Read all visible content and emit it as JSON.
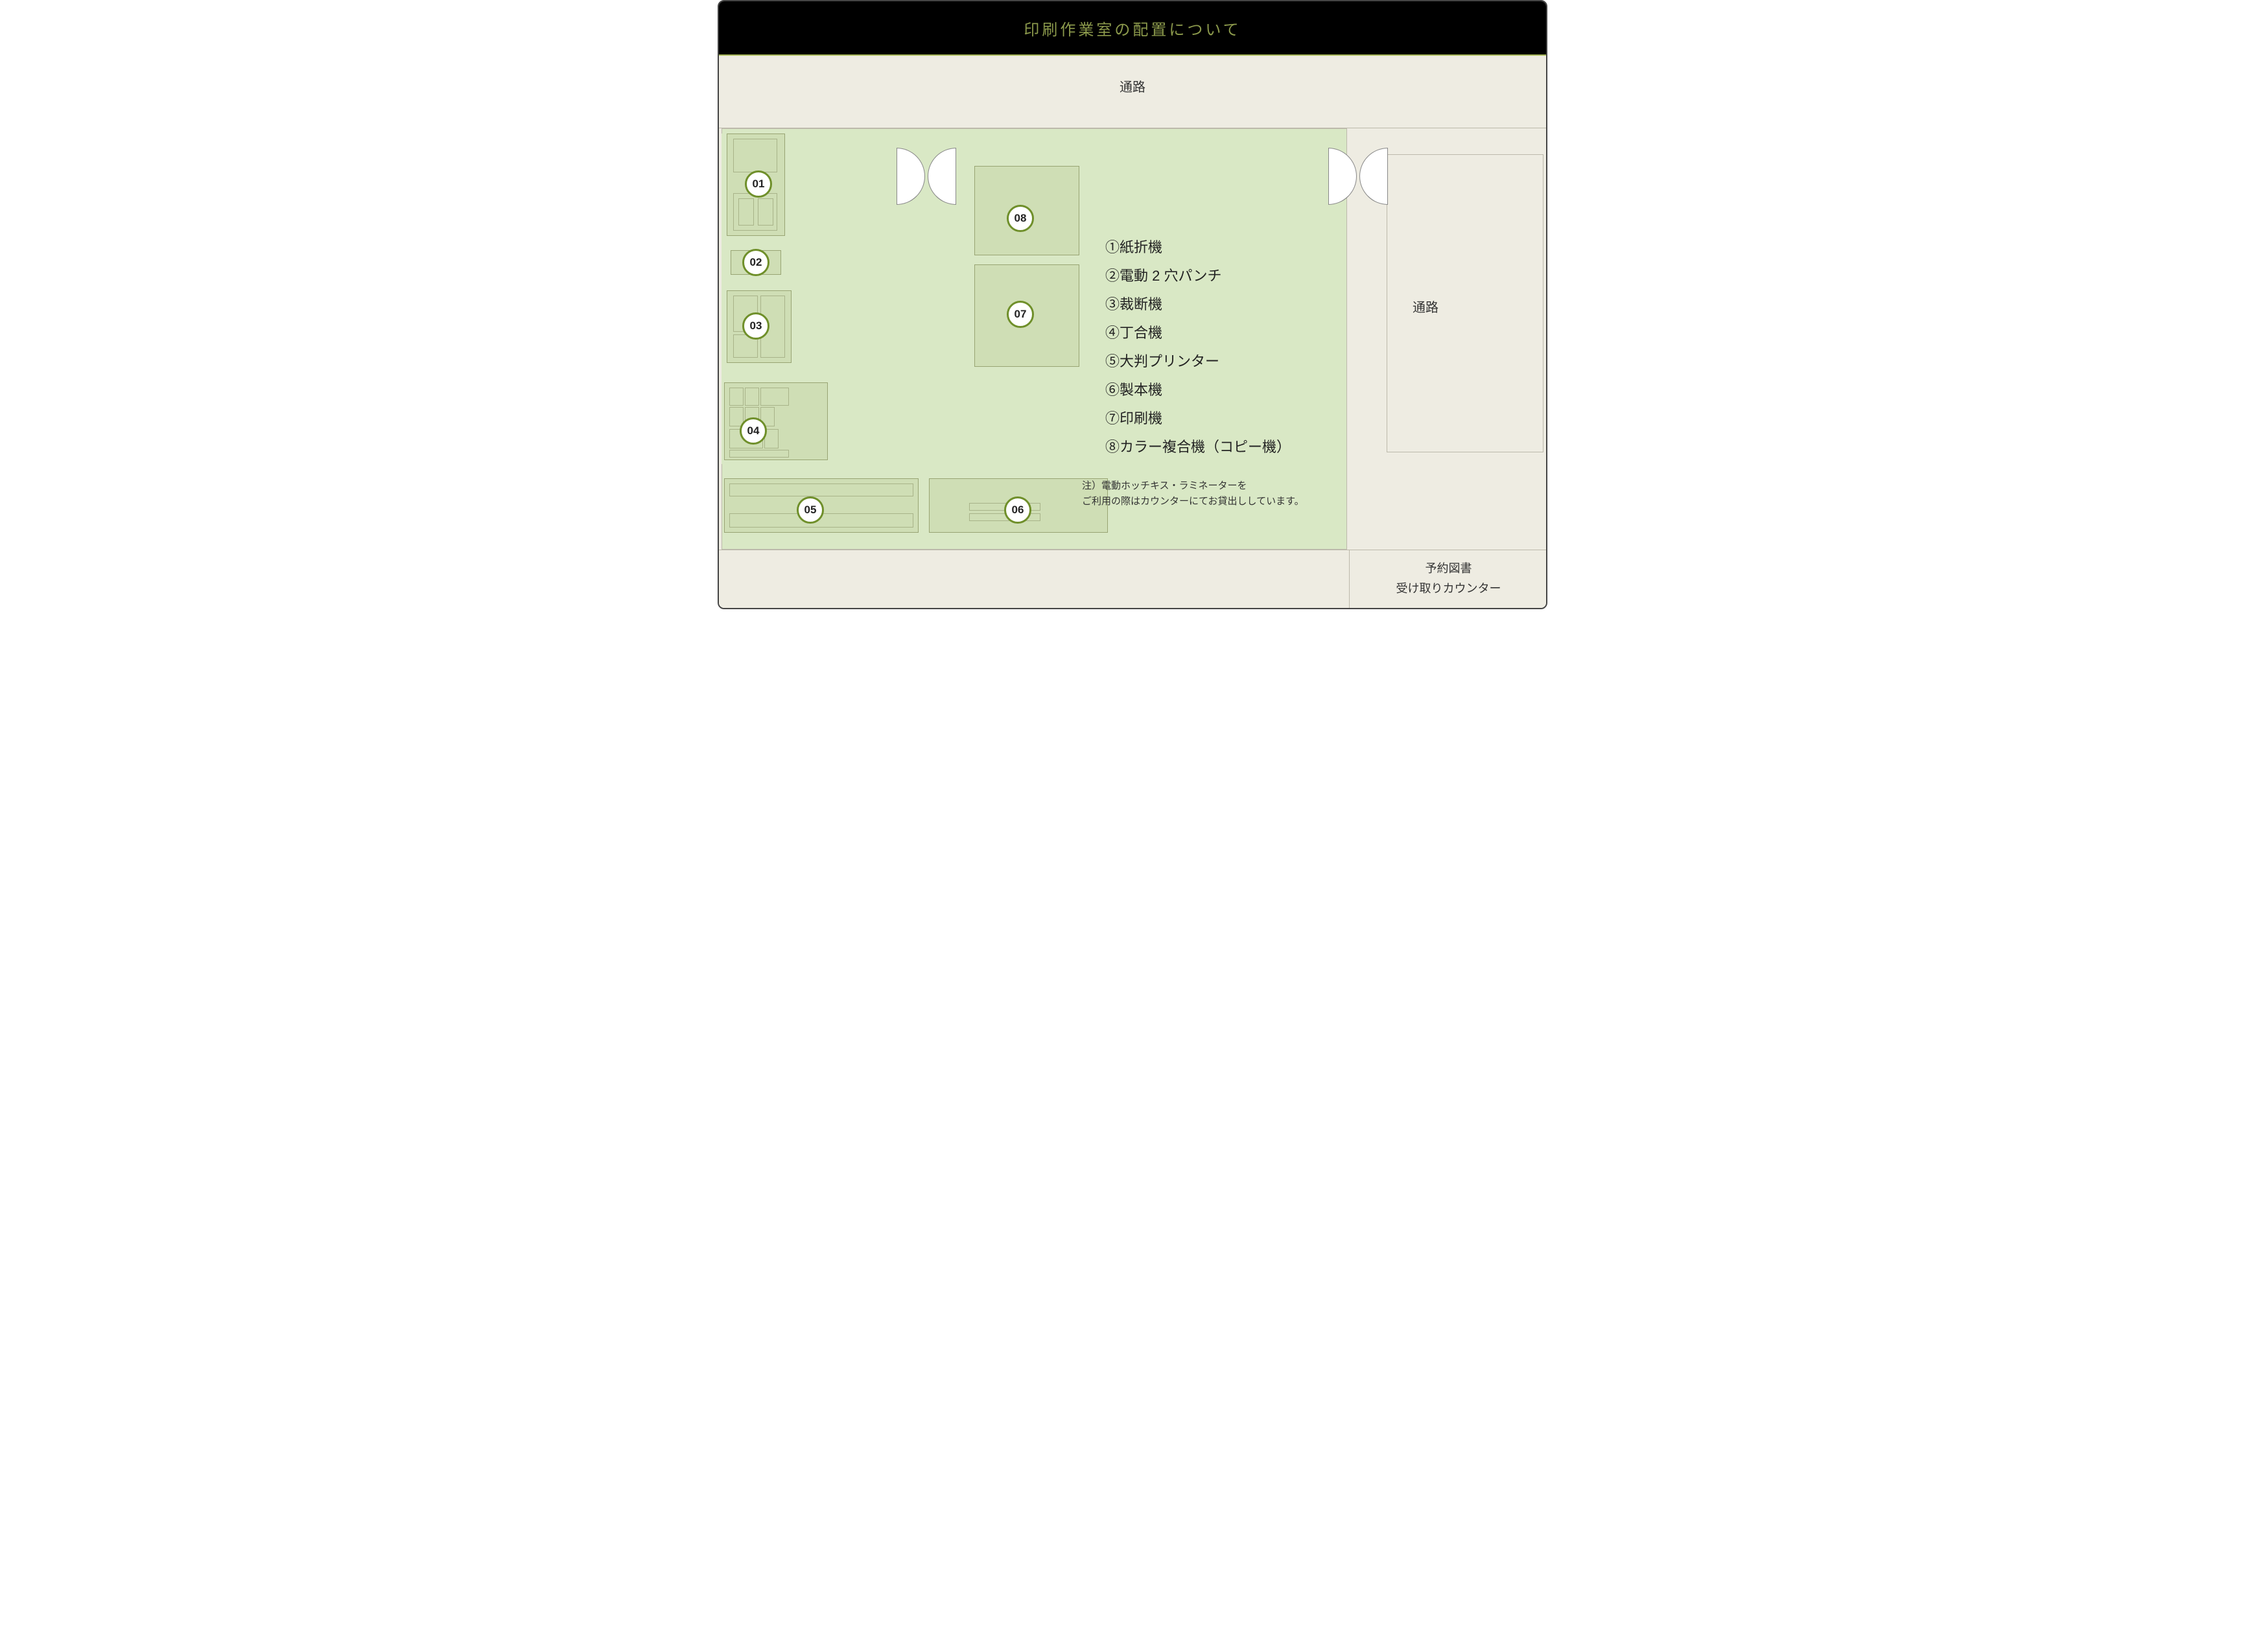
{
  "title": "印刷作業室の配置について",
  "corridor_top": "通路",
  "corridor_right": "通路",
  "reserved_counter_line1": "予約図書",
  "reserved_counter_line2": "受け取りカウンター",
  "markers": {
    "m01": "01",
    "m02": "02",
    "m03": "03",
    "m04": "04",
    "m05": "05",
    "m06": "06",
    "m07": "07",
    "m08": "08"
  },
  "legend": {
    "l1": "①紙折機",
    "l2": "②電動 2 穴パンチ",
    "l3": "③裁断機",
    "l4": "④丁合機",
    "l5": "⑤大判プリンター",
    "l6": "⑥製本機",
    "l7": "⑦印刷機",
    "l8": "⑧カラー複合機（コピー機）"
  },
  "note_l1": "注）電動ホッチキス・ラミネーターを",
  "note_l2": "ご利用の際はカウンターにてお貸出ししています。"
}
